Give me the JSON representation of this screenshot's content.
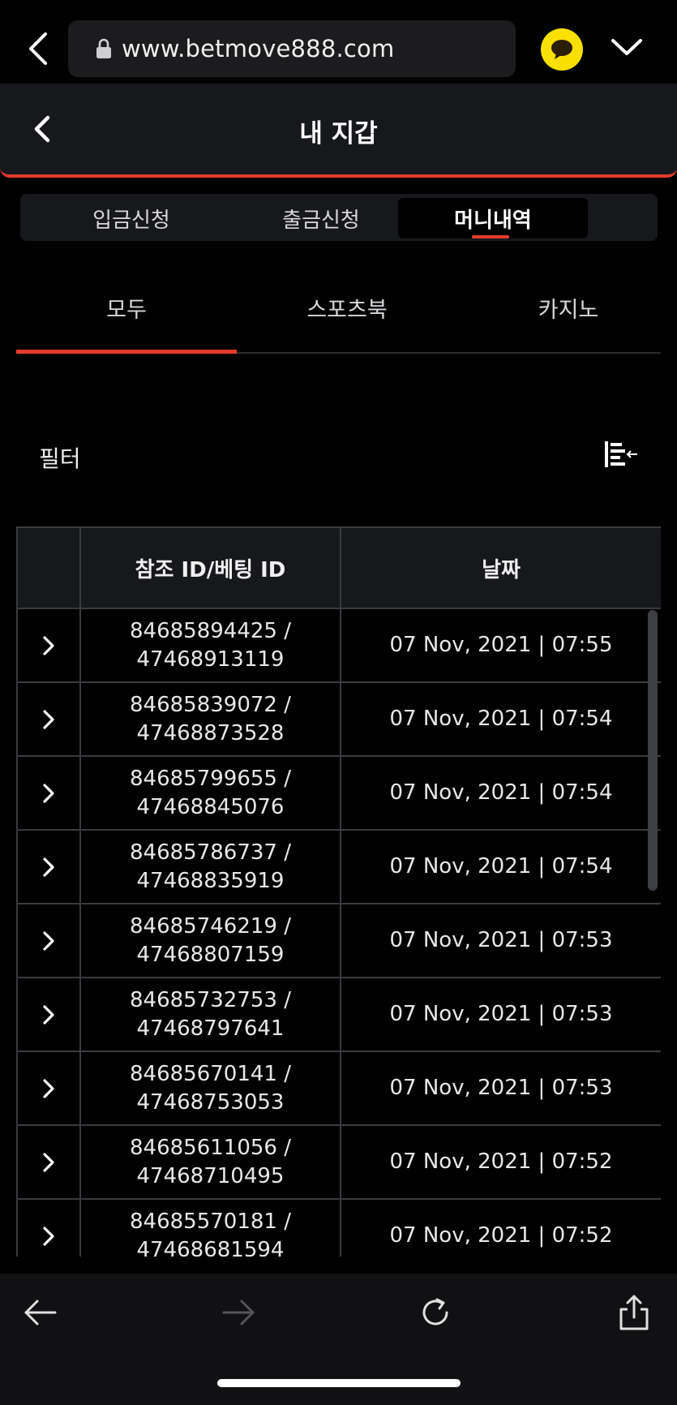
{
  "browser": {
    "url": "www.betmove888.com"
  },
  "header": {
    "title": "내 지갑"
  },
  "segmented_tabs": [
    {
      "label": "입금신청",
      "active": false
    },
    {
      "label": "출금신청",
      "active": false
    },
    {
      "label": "머니내역",
      "active": true
    }
  ],
  "category_tabs": [
    {
      "label": "모두",
      "active": true
    },
    {
      "label": "스포츠북",
      "active": false
    },
    {
      "label": "카지노",
      "active": false
    }
  ],
  "filter": {
    "label": "필터",
    "icon": "filter-collapse-icon"
  },
  "table": {
    "columns": [
      "",
      "참조 ID/베팅 ID",
      "날짜"
    ],
    "rows": [
      {
        "ref_id": "84685894425 /",
        "bet_id": "47468913119",
        "date": "07 Nov, 2021 | 07:55"
      },
      {
        "ref_id": "84685839072 /",
        "bet_id": "47468873528",
        "date": "07 Nov, 2021 | 07:54"
      },
      {
        "ref_id": "84685799655 /",
        "bet_id": "47468845076",
        "date": "07 Nov, 2021 | 07:54"
      },
      {
        "ref_id": "84685786737 /",
        "bet_id": "47468835919",
        "date": "07 Nov, 2021 | 07:54"
      },
      {
        "ref_id": "84685746219 /",
        "bet_id": "47468807159",
        "date": "07 Nov, 2021 | 07:53"
      },
      {
        "ref_id": "84685732753 /",
        "bet_id": "47468797641",
        "date": "07 Nov, 2021 | 07:53"
      },
      {
        "ref_id": "84685670141 /",
        "bet_id": "47468753053",
        "date": "07 Nov, 2021 | 07:53"
      },
      {
        "ref_id": "84685611056 /",
        "bet_id": "47468710495",
        "date": "07 Nov, 2021 | 07:52"
      },
      {
        "ref_id": "84685570181 /",
        "bet_id": "47468681594",
        "date": "07 Nov, 2021 | 07:52"
      }
    ]
  },
  "colors": {
    "accent": "#e53b2c",
    "panel": "#17181c",
    "chat_yellow": "#f9e000"
  },
  "icons": {
    "browser_back": "chevron-left-icon",
    "lock": "lock-icon",
    "chat": "chat-bubble-icon",
    "expand": "chevron-down-icon",
    "row_expand": "chevron-right-icon",
    "nav_back": "arrow-left-icon",
    "nav_forward": "arrow-right-icon",
    "reload": "reload-icon",
    "share": "share-icon"
  }
}
